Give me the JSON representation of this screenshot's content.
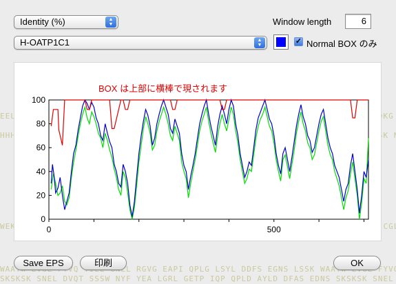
{
  "toolbar": {
    "metric_select": "Identity (%)",
    "window_length_label": "Window length",
    "window_length_value": "6",
    "sequence_select": "H-OATP1C1",
    "color_swatch": "#0000ff",
    "normal_box_checked": true,
    "normal_box_label": "Normal BOX のみ"
  },
  "plot": {
    "annotation": "BOX は上部に横棒で現されます",
    "y_ticks": [
      "0",
      "20",
      "40",
      "60",
      "80",
      "100"
    ],
    "x_ticks": [
      "0",
      "500"
    ]
  },
  "chart_data": {
    "type": "line",
    "title": "",
    "xlabel": "",
    "ylabel": "",
    "xlim": [
      0,
      710
    ],
    "ylim": [
      0,
      100
    ],
    "y_ticks": [
      0,
      20,
      40,
      60,
      80,
      100
    ],
    "x_ticks": [
      0,
      500
    ],
    "colors": {
      "box": "#e00000",
      "blue": "#0000cc",
      "green": "#00dd00"
    },
    "series": [
      {
        "color": "#e00000",
        "x": [
          5,
          10,
          12,
          20,
          22,
          30,
          35,
          80,
          85,
          90,
          95,
          100,
          105,
          130,
          135,
          140,
          145,
          160,
          165,
          170,
          175,
          180,
          270,
          275,
          280,
          285,
          290,
          380,
          385,
          390,
          395,
          400,
          670,
          675,
          680,
          685,
          690,
          710
        ],
        "y": [
          78,
          92,
          92,
          92,
          75,
          62,
          100,
          100,
          92,
          92,
          100,
          100,
          100,
          100,
          100,
          76,
          76,
          100,
          100,
          92,
          92,
          100,
          100,
          92,
          92,
          100,
          100,
          100,
          92,
          92,
          100,
          100,
          100,
          85,
          85,
          100,
          100,
          100
        ]
      },
      {
        "color": "#0000cc",
        "x": [
          5,
          8,
          12,
          15,
          20,
          25,
          30,
          35,
          40,
          45,
          50,
          55,
          60,
          65,
          70,
          75,
          80,
          85,
          90,
          95,
          100,
          105,
          110,
          115,
          120,
          125,
          130,
          135,
          140,
          145,
          150,
          155,
          160,
          165,
          170,
          175,
          180,
          185,
          190,
          195,
          200,
          205,
          210,
          215,
          220,
          225,
          230,
          235,
          240,
          245,
          250,
          255,
          260,
          265,
          270,
          275,
          280,
          285,
          290,
          295,
          300,
          305,
          310,
          315,
          320,
          325,
          330,
          335,
          340,
          345,
          350,
          355,
          360,
          365,
          370,
          375,
          380,
          385,
          390,
          395,
          400,
          405,
          410,
          415,
          420,
          425,
          430,
          435,
          440,
          445,
          450,
          455,
          460,
          465,
          470,
          475,
          480,
          485,
          490,
          495,
          500,
          505,
          510,
          515,
          520,
          525,
          530,
          535,
          540,
          545,
          550,
          555,
          560,
          565,
          570,
          575,
          580,
          585,
          590,
          595,
          600,
          605,
          610,
          615,
          620,
          625,
          630,
          635,
          640,
          645,
          650,
          655,
          660,
          665,
          670,
          675,
          680,
          685,
          690,
          695,
          700,
          705,
          710
        ],
        "y": [
          30,
          46,
          35,
          22,
          26,
          35,
          20,
          8,
          15,
          22,
          40,
          55,
          62,
          75,
          85,
          95,
          100,
          97,
          92,
          98,
          94,
          85,
          80,
          70,
          66,
          80,
          72,
          65,
          60,
          46,
          40,
          30,
          27,
          46,
          40,
          30,
          12,
          2,
          15,
          35,
          55,
          70,
          82,
          92,
          87,
          78,
          62,
          68,
          80,
          88,
          95,
          100,
          94,
          88,
          76,
          72,
          84,
          78,
          72,
          55,
          45,
          40,
          25,
          36,
          45,
          55,
          68,
          80,
          88,
          95,
          100,
          88,
          78,
          70,
          62,
          78,
          88,
          95,
          88,
          80,
          92,
          100,
          95,
          80,
          70,
          55,
          45,
          35,
          40,
          48,
          45,
          60,
          75,
          85,
          90,
          95,
          100,
          92,
          84,
          80,
          70,
          55,
          45,
          38,
          55,
          60,
          50,
          40,
          52,
          65,
          78,
          88,
          96,
          86,
          80,
          70,
          66,
          56,
          60,
          70,
          80,
          88,
          92,
          80,
          68,
          60,
          55,
          45,
          40,
          35,
          25,
          15,
          25,
          30,
          45,
          55,
          40,
          25,
          5,
          20,
          40,
          35,
          50
        ]
      },
      {
        "color": "#00dd00",
        "x": [
          5,
          10,
          15,
          20,
          25,
          30,
          35,
          40,
          45,
          50,
          55,
          60,
          65,
          70,
          75,
          80,
          85,
          90,
          95,
          100,
          105,
          110,
          115,
          120,
          125,
          130,
          135,
          140,
          145,
          150,
          155,
          160,
          165,
          170,
          175,
          180,
          185,
          190,
          195,
          200,
          205,
          210,
          215,
          220,
          225,
          230,
          235,
          240,
          245,
          250,
          255,
          260,
          265,
          270,
          275,
          280,
          285,
          290,
          295,
          300,
          305,
          310,
          315,
          320,
          325,
          330,
          335,
          340,
          345,
          350,
          355,
          360,
          365,
          370,
          375,
          380,
          385,
          390,
          395,
          400,
          405,
          410,
          415,
          420,
          425,
          430,
          435,
          440,
          445,
          450,
          455,
          460,
          465,
          470,
          475,
          480,
          485,
          490,
          495,
          500,
          505,
          510,
          515,
          520,
          525,
          530,
          535,
          540,
          545,
          550,
          555,
          560,
          565,
          570,
          575,
          580,
          585,
          590,
          595,
          600,
          605,
          610,
          615,
          620,
          625,
          630,
          635,
          640,
          645,
          650,
          655,
          660,
          665,
          670,
          675,
          680,
          685,
          690,
          695,
          700,
          705,
          710
        ],
        "y": [
          25,
          38,
          30,
          20,
          22,
          28,
          15,
          12,
          18,
          35,
          48,
          58,
          70,
          80,
          88,
          94,
          85,
          80,
          90,
          86,
          80,
          72,
          68,
          60,
          72,
          66,
          58,
          52,
          42,
          35,
          25,
          20,
          40,
          35,
          22,
          8,
          0,
          10,
          28,
          48,
          62,
          76,
          86,
          80,
          72,
          58,
          62,
          74,
          82,
          88,
          94,
          88,
          80,
          70,
          66,
          78,
          72,
          66,
          48,
          40,
          34,
          18,
          30,
          40,
          50,
          62,
          74,
          82,
          88,
          94,
          82,
          72,
          64,
          56,
          70,
          80,
          88,
          80,
          74,
          84,
          94,
          88,
          74,
          64,
          50,
          40,
          30,
          34,
          42,
          40,
          54,
          68,
          78,
          84,
          88,
          94,
          86,
          78,
          74,
          64,
          50,
          40,
          32,
          50,
          54,
          44,
          34,
          46,
          58,
          72,
          82,
          90,
          80,
          74,
          64,
          60,
          50,
          54,
          64,
          74,
          82,
          86,
          74,
          62,
          54,
          50,
          40,
          34,
          28,
          18,
          8,
          18,
          24,
          38,
          48,
          34,
          20,
          0,
          14,
          34,
          30,
          68
        ]
      }
    ]
  }
}
